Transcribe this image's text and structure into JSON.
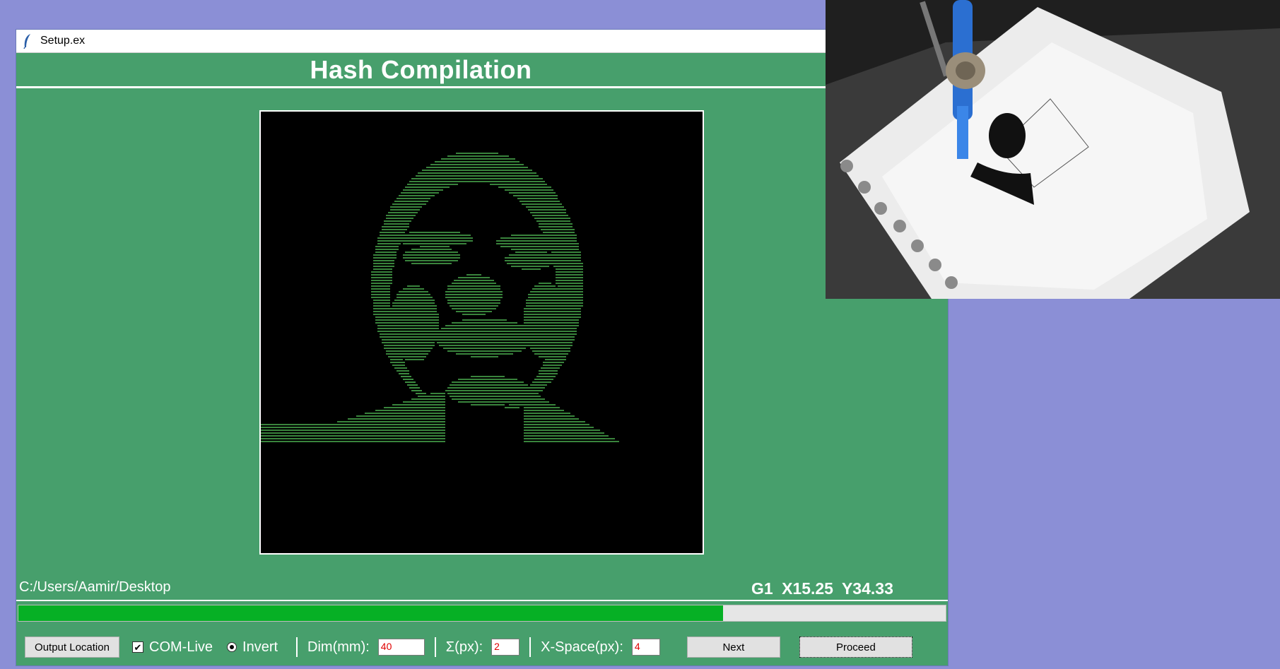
{
  "window": {
    "title": "Setup.ex"
  },
  "header": {
    "title": "Hash Compilation"
  },
  "status": {
    "output_path": "C:/Users/Aamir/Desktop",
    "gcode_command": "G1",
    "gcode_x": "X15.25",
    "gcode_y": "Y34.33"
  },
  "progress": {
    "fraction": 0.76
  },
  "controls": {
    "output_location_label": "Output Location",
    "com_live_label": "COM-Live",
    "com_live_checked": true,
    "invert_label": "Invert",
    "invert_selected": true,
    "dim_label": "Dim(mm):",
    "dim_value": "40",
    "sigma_label": "Σ(px):",
    "sigma_value": "2",
    "xspace_label": "X-Space(px):",
    "xspace_value": "4",
    "next_label": "Next",
    "proceed_label": "Proceed"
  },
  "colors": {
    "window_bg": "#479f6c",
    "preview_line": "#4caf50",
    "progress_fill": "#06b025",
    "desktop_bg": "#8b8fd6",
    "field_text": "#e00000"
  },
  "icons": {
    "app": "feather-icon"
  }
}
